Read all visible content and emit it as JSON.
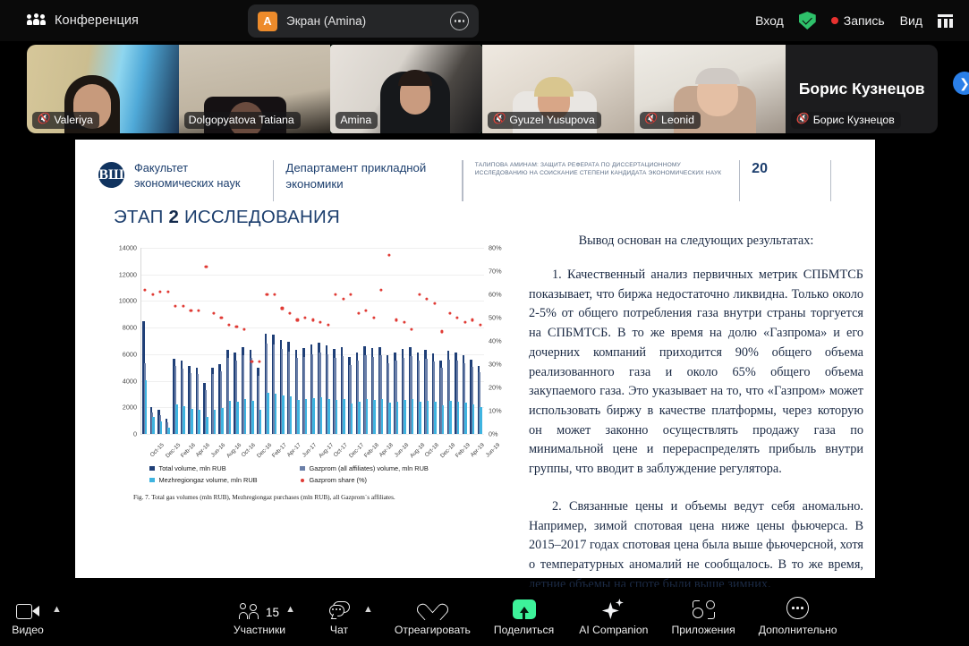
{
  "topbar": {
    "meeting_label": "Конференция",
    "meeting_icon": "people-icon",
    "share_avatar_letter": "A",
    "share_label": "Экран (Amina)",
    "share_more_icon": "more-dots-icon",
    "login_label": "Вход",
    "security_icon": "green-shield-check-icon",
    "recording_label": "Запись",
    "view_label": "Вид",
    "view_icon": "grid-layout-icon"
  },
  "filmstrip": {
    "next_icon": "chevron-right-icon",
    "participants": [
      {
        "name": "Valeriya",
        "muted": true,
        "active": false,
        "video": true
      },
      {
        "name": "Dolgopyatova Tatiana",
        "muted": false,
        "active": false,
        "video": true
      },
      {
        "name": "Amina",
        "muted": false,
        "active": true,
        "video": true
      },
      {
        "name": "Gyuzel Yusupova",
        "muted": true,
        "active": false,
        "video": true
      },
      {
        "name": "Leonid",
        "muted": true,
        "active": false,
        "video": true
      },
      {
        "name": "Борис Кузнецов",
        "muted": true,
        "active": false,
        "video": false
      }
    ]
  },
  "slide": {
    "logo_mark": "ВШ",
    "faculty": "Факультет\nэкономических наук",
    "department": "Департамент прикладной\nэкономики",
    "meta": "ТАЛИПОВА АМИНАМ: ЗАЩИТА РЕФЕРАТА ПО ДИССЕРТАЦИОННОМУ ИССЛЕДОВАНИЮ НА СОИСКАНИЕ СТЕПЕНИ КАНДИДАТА ЭКОНОМИЧЕСКИХ НАУК",
    "page_number": "20",
    "title_prefix": "ЭТАП ",
    "title_number": "2",
    "title_suffix": " ИССЛЕДОВАНИЯ",
    "caption": "Fig. 7.  Total gas volumes (mln RUB), Mezhregiongaz purchases (mln RUB), all Gazprom`s affiliates.",
    "lead": "Вывод основан на следующих результатах:",
    "paragraph_1": "1. Качественный анализ первичных метрик СПБМТСБ показывает, что биржа недостаточно ликвидна. Только около 2-5% от общего потребления газа внутри страны торгуется на СПБМТСБ. В то же время на долю «Газпрома» и его дочерних компаний приходится 90% общего объема реализованного газа и около 65% общего объема закупаемого газа. Это указывает на то, что «Газпром» может использовать биржу в качестве платформы, через которую он может законно осуществлять продажу газа по минимальной цене и перераспределять прибыль внутри группы, что вводит в заблуждение регулятора.",
    "paragraph_2": "2. Связанные цены и объемы ведут себя аномально. Например, зимой спотовая цена ниже цены фьючерса. В 2015–2017 годах спотовая цена была выше фьючерсной, хотя о температурных аномалий не сообщалось. В то же время, летние объемы на споте были выше зимних."
  },
  "chart_data": {
    "type": "bar",
    "title": "",
    "xlabel": "",
    "ylabel": "",
    "ylim": [
      0,
      14000
    ],
    "y2lim": [
      0,
      80
    ],
    "grid": true,
    "legend_position": "bottom",
    "yticks": [
      "0",
      "2000",
      "4000",
      "6000",
      "8000",
      "10000",
      "12000",
      "14000"
    ],
    "y2ticks": [
      "0%",
      "10%",
      "20%",
      "30%",
      "40%",
      "50%",
      "60%",
      "70%",
      "80%"
    ],
    "categories": [
      "Oct-15",
      "Nov-15",
      "Dec-15",
      "Jan-16",
      "Feb-16",
      "Mar-16",
      "Apr-16",
      "May-16",
      "Jun-16",
      "Jul-16",
      "Aug-16",
      "Sep-16",
      "Oct-16",
      "Nov-16",
      "Dec-16",
      "Jan-17",
      "Feb-17",
      "Mar-17",
      "Apr-17",
      "May-17",
      "Jun-17",
      "Jul-17",
      "Aug-17",
      "Sep-17",
      "Oct-17",
      "Nov-17",
      "Dec-17",
      "Jan-18",
      "Feb-18",
      "Mar-18",
      "Apr-18",
      "May-18",
      "Jun-18",
      "Jul-18",
      "Aug-18",
      "Sep-18",
      "Oct-18",
      "Nov-18",
      "Dec-18",
      "Jan-19",
      "Feb-19",
      "Mar-19",
      "Apr-19",
      "May-19",
      "Jun-19"
    ],
    "xtick_labels": [
      "Oct-15",
      "Dec-15",
      "Feb-16",
      "Apr-16",
      "Jun-16",
      "Aug-16",
      "Oct-16",
      "Dec-16",
      "Feb-17",
      "Apr-17",
      "Jun-17",
      "Aug-17",
      "Oct-17",
      "Dec-17",
      "Feb-18",
      "Apr-18",
      "Jun-18",
      "Aug-18",
      "Oct-18",
      "Dec-18",
      "Feb-19",
      "Apr-19",
      "Jun-19"
    ],
    "series": [
      {
        "name": "Total volume, mln RUB",
        "color": "#1f3f77",
        "values": [
          8450,
          2050,
          1800,
          1150,
          5650,
          5500,
          5100,
          5000,
          3850,
          5000,
          5250,
          6350,
          6100,
          6550,
          6350,
          4950,
          7550,
          7450,
          7100,
          6950,
          6350,
          6450,
          6700,
          6850,
          6650,
          6400,
          6500,
          5800,
          6100,
          6600,
          6450,
          6550,
          5900,
          6100,
          6400,
          6500,
          6150,
          6300,
          6050,
          5500,
          6250,
          6100,
          5900,
          5600,
          5150
        ]
      },
      {
        "name": "Gazprom (all affiliates) volume, mln RUB",
        "color": "#6b7fa8",
        "values": [
          5350,
          1600,
          1400,
          850,
          5100,
          4900,
          4600,
          4500,
          3300,
          4500,
          4700,
          5700,
          5500,
          5900,
          5700,
          4400,
          6800,
          6700,
          6400,
          6200,
          5700,
          5800,
          6000,
          6150,
          6000,
          5750,
          5850,
          5200,
          5500,
          5950,
          5800,
          5900,
          5300,
          5500,
          5750,
          5850,
          5550,
          5650,
          5450,
          4950,
          5600,
          5500,
          5300,
          5050,
          4650
        ]
      },
      {
        "name": "Mezhregiongaz volume, mln RUB",
        "color": "#3fb4e0",
        "values": [
          4050,
          1250,
          950,
          450,
          2200,
          2100,
          1900,
          1850,
          1300,
          1800,
          1950,
          2500,
          2400,
          2600,
          2500,
          1850,
          3100,
          3050,
          2900,
          2800,
          2550,
          2600,
          2700,
          2750,
          2650,
          2550,
          2600,
          2300,
          2450,
          2650,
          2550,
          2600,
          2350,
          2450,
          2550,
          2600,
          2450,
          2500,
          2400,
          2150,
          2500,
          2450,
          2350,
          2250,
          2050
        ]
      }
    ],
    "scatter_series": {
      "name": "Gazprom share (%)",
      "color": "#e03b35",
      "values": [
        62,
        60,
        61,
        61,
        55,
        55,
        53,
        53,
        72,
        52,
        50,
        47,
        46,
        45,
        31,
        31,
        60,
        60,
        54,
        52,
        49,
        50,
        49,
        48,
        47,
        60,
        58,
        60,
        52,
        53,
        50,
        62,
        77,
        49,
        48,
        45,
        60,
        58,
        56,
        44,
        52,
        50,
        48,
        49,
        47
      ]
    }
  },
  "bottombar": {
    "items": [
      {
        "label": "Видео",
        "icon": "camera-icon",
        "caret": true,
        "count": null
      },
      {
        "label": "Участники",
        "icon": "participants-icon",
        "caret": true,
        "count": "15"
      },
      {
        "label": "Чат",
        "icon": "chat-bubble-icon",
        "caret": true,
        "count": null
      },
      {
        "label": "Отреагировать",
        "icon": "heart-icon",
        "caret": false,
        "count": null
      },
      {
        "label": "Поделиться",
        "icon": "share-screen-icon",
        "caret": false,
        "count": null
      },
      {
        "label": "AI Companion",
        "icon": "sparkle-icon",
        "caret": false,
        "count": null
      },
      {
        "label": "Приложения",
        "icon": "apps-icon",
        "caret": false,
        "count": null
      },
      {
        "label": "Дополнительно",
        "icon": "more-dots-icon",
        "caret": false,
        "count": null
      }
    ]
  },
  "colors": {
    "accent_green": "#3df29a",
    "record_red": "#e8312f",
    "active_speaker": "#5df2a6",
    "brand_navy": "#1d3f6e"
  }
}
